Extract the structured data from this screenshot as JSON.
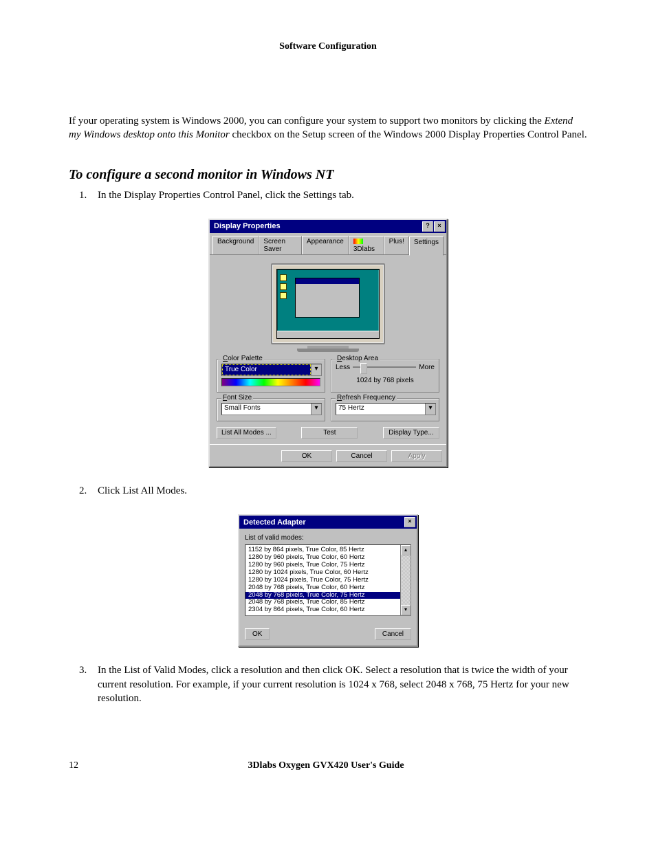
{
  "header": "Software Configuration",
  "intro_before_em": "If your operating system is Windows 2000, you can configure your system to support two monitors by clicking the ",
  "intro_em": "Extend my Windows desktop onto this Monitor",
  "intro_after_em": " checkbox on the Setup screen of the Windows 2000 Display Properties Control Panel.",
  "section_heading": "To configure a second monitor in Windows NT",
  "steps": {
    "s1": "In the Display Properties Control Panel, click the Settings tab.",
    "s2": "Click List All Modes.",
    "s3": "In the List of Valid Modes, click a resolution and then click OK. Select a resolution that is twice the width of your current resolution. For example, if your current resolution is 1024 x 768, select 2048 x 768, 75 Hertz for your new resolution."
  },
  "dialog1": {
    "title": "Display Properties",
    "tabs": [
      "Background",
      "Screen Saver",
      "Appearance",
      "3Dlabs",
      "Plus!",
      "Settings"
    ],
    "active_tab_index": 5,
    "color_palette": {
      "label": "Color Palette",
      "value": "True Color"
    },
    "desktop_area": {
      "label": "Desktop Area",
      "less": "Less",
      "more": "More",
      "value": "1024 by 768 pixels"
    },
    "font_size": {
      "label": "Font Size",
      "value": "Small Fonts"
    },
    "refresh": {
      "label": "Refresh Frequency",
      "value": "75 Hertz"
    },
    "buttons": {
      "list_modes": "List All Modes ...",
      "test": "Test",
      "display_type": "Display Type..."
    },
    "footer": {
      "ok": "OK",
      "cancel": "Cancel",
      "apply": "Apply"
    }
  },
  "dialog2": {
    "title": "Detected Adapter",
    "list_label": "List of valid modes:",
    "modes": [
      "1152 by 864 pixels, True Color, 85 Hertz",
      "1280 by 960 pixels, True Color, 60 Hertz",
      "1280 by 960 pixels, True Color, 75 Hertz",
      "1280 by 1024 pixels, True Color, 60 Hertz",
      "1280 by 1024 pixels, True Color, 75 Hertz",
      "2048 by 768 pixels, True Color, 60 Hertz",
      "2048 by 768 pixels, True Color, 75 Hertz",
      "2048 by 768 pixels, True Color, 85 Hertz",
      "2304 by 864 pixels, True Color, 60 Hertz"
    ],
    "selected_index": 6,
    "ok": "OK",
    "cancel": "Cancel"
  },
  "footer": {
    "page": "12",
    "guide": "3Dlabs Oxygen GVX420 User's Guide"
  }
}
